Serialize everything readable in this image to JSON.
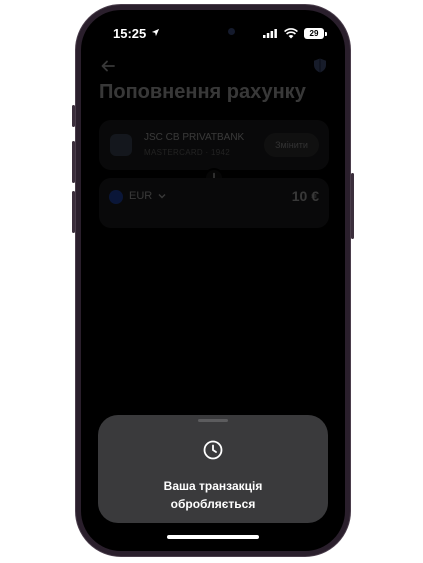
{
  "status_bar": {
    "time": "15:25",
    "battery": "29"
  },
  "page": {
    "title": "Поповнення рахунку"
  },
  "source_card": {
    "bank_name": "JSC CB PRIVATBANK",
    "card_info": "MASTERCARD · 1942",
    "change_label": "Змінити"
  },
  "amount_card": {
    "currency": "EUR",
    "amount": "10 €"
  },
  "sheet": {
    "message_line1": "Ваша транзакція",
    "message_line2": "обробляється"
  }
}
